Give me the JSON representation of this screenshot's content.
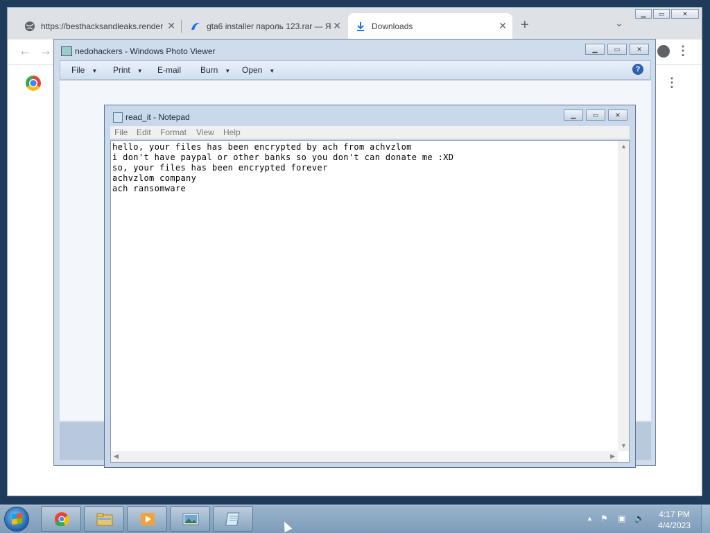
{
  "chrome": {
    "tabs": [
      {
        "title": "https://besthacksandleaks.render",
        "icon": "globe-icon"
      },
      {
        "title": "gta6 installer пароль 123.rar — Я",
        "icon": "download-cloud-icon"
      },
      {
        "title": "Downloads",
        "icon": "download-icon"
      }
    ],
    "new_tab_label": "+",
    "tab_search_label": "⌄",
    "close_label": "✕",
    "minimize_label": "▁",
    "maximize_label": "▭"
  },
  "photo_viewer": {
    "title": "nedohackers - Windows Photo Viewer",
    "menu": [
      {
        "label": "File",
        "has_dropdown": true
      },
      {
        "label": "Print",
        "has_dropdown": true
      },
      {
        "label": "E-mail",
        "has_dropdown": false
      },
      {
        "label": "Burn",
        "has_dropdown": true
      },
      {
        "label": "Open",
        "has_dropdown": true
      }
    ],
    "help_label": "?"
  },
  "notepad": {
    "title": "read_it - Notepad",
    "menu": [
      "File",
      "Edit",
      "Format",
      "View",
      "Help"
    ],
    "lines": [
      "hello, your files has been encrypted by ach from achvzlom",
      "i don't have paypal or other banks so you don't can donate me :XD",
      "so, your files has been encrypted forever",
      "achvzlom company",
      "ach ransomware"
    ]
  },
  "taskbar": {
    "pinned": [
      "chrome-icon",
      "explorer-icon",
      "media-player-icon",
      "photo-viewer-icon",
      "notepad-icon"
    ],
    "time": "4:17 PM",
    "date": "4/4/2023",
    "tray_arrow": "▲",
    "colors": {
      "bar_top": "#9bb4cc",
      "bar_bottom": "#7d9cb9"
    }
  }
}
